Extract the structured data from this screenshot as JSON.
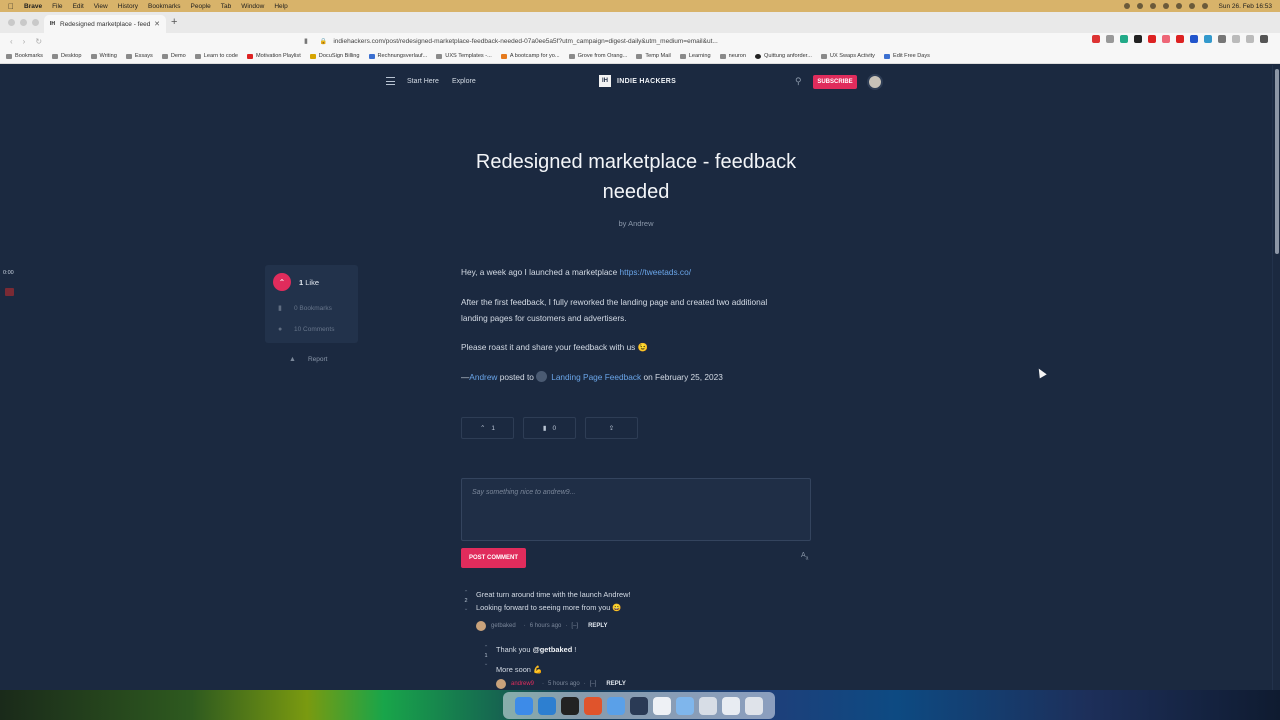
{
  "menubar": {
    "app": "Brave",
    "items": [
      "File",
      "Edit",
      "View",
      "History",
      "Bookmarks",
      "People",
      "Tab",
      "Window",
      "Help"
    ],
    "clock": "Sun 26. Feb  16:53"
  },
  "browser": {
    "tab_title": "Redesigned marketplace - feed",
    "tab_favicon": "IH",
    "url": "indiehackers.com/post/redesigned-marketplace-feedback-needed-07a0ee5a5f?utm_campaign=digest-daily&utm_medium=email&ut...",
    "bookmarks": [
      {
        "label": "Bookmarks",
        "color": "gray"
      },
      {
        "label": "Desktop",
        "color": "gray"
      },
      {
        "label": "Writing",
        "color": "gray"
      },
      {
        "label": "Essays",
        "color": "gray"
      },
      {
        "label": "Demo",
        "color": "gray"
      },
      {
        "label": "Learn to code",
        "color": "gray"
      },
      {
        "label": "Motivation Playlist",
        "color": "red"
      },
      {
        "label": "DocuSign Billing",
        "color": "yel"
      },
      {
        "label": "Rechnungsverlauf...",
        "color": "blu"
      },
      {
        "label": "UXS Templates -...",
        "color": "gray"
      },
      {
        "label": "A bootcamp for yo...",
        "color": "org"
      },
      {
        "label": "Grove from Orang...",
        "color": "gray"
      },
      {
        "label": "Temp Mail",
        "color": "gray"
      },
      {
        "label": "Learning",
        "color": "gray"
      },
      {
        "label": "neuron",
        "color": "gray"
      },
      {
        "label": "Quittung anforder...",
        "color": "blk"
      },
      {
        "label": "UX Swaps Activity",
        "color": "gray"
      },
      {
        "label": "Edit Free Days",
        "color": "blu"
      }
    ]
  },
  "site": {
    "nav": {
      "start_here": "Start Here",
      "explore": "Explore",
      "brand": "INDIE HACKERS",
      "brand_mark": "IH",
      "subscribe": "SUBSCRIBE"
    },
    "post": {
      "title": "Redesigned marketplace - feedback needed",
      "byline_prefix": "by",
      "author": "Andrew",
      "p1_text": "Hey, a week ago I launched a marketplace",
      "p1_link": "https://tweetads.co/",
      "p2": "After the first feedback, I fully reworked the landing page and created two additional landing pages for customers and advertisers.",
      "p3": "Please roast it and share your feedback with us 😉",
      "posted_dash": "—",
      "posted_author": "Andrew",
      "posted_to": "posted to",
      "group": "Landing Page Feedback",
      "posted_on": "on February 25, 2023"
    },
    "sidebar": {
      "likes_count": "1",
      "likes_label": "Like",
      "bookmarks": "0 Bookmarks",
      "comments": "10 Comments",
      "report": "Report"
    },
    "actions": {
      "upvotes": "1",
      "bookmarks": "0"
    },
    "comment_form": {
      "placeholder": "Say something nice to andrew9...",
      "submit": "POST COMMENT"
    },
    "comments": [
      {
        "votes": "2",
        "line1": "Great turn around time with the launch Andrew!",
        "line2": "Looking forward to seeing more from you 😀",
        "user": "getbaked",
        "time": "6 hours ago",
        "collapse": "[–]",
        "reply": "REPLY"
      },
      {
        "votes": "1",
        "line1_prefix": "Thank you",
        "mention": "@getbaked",
        "line1_suffix": "!",
        "line2": "More soon 💪",
        "user": "andrew9",
        "time": "5 hours ago",
        "collapse": "[–]",
        "reply": "REPLY"
      }
    ]
  },
  "overlay": {
    "timer": "0:00"
  },
  "colors": {
    "page_bg": "#1b2940",
    "accent": "#e02c5c",
    "link": "#6aa5e8"
  }
}
